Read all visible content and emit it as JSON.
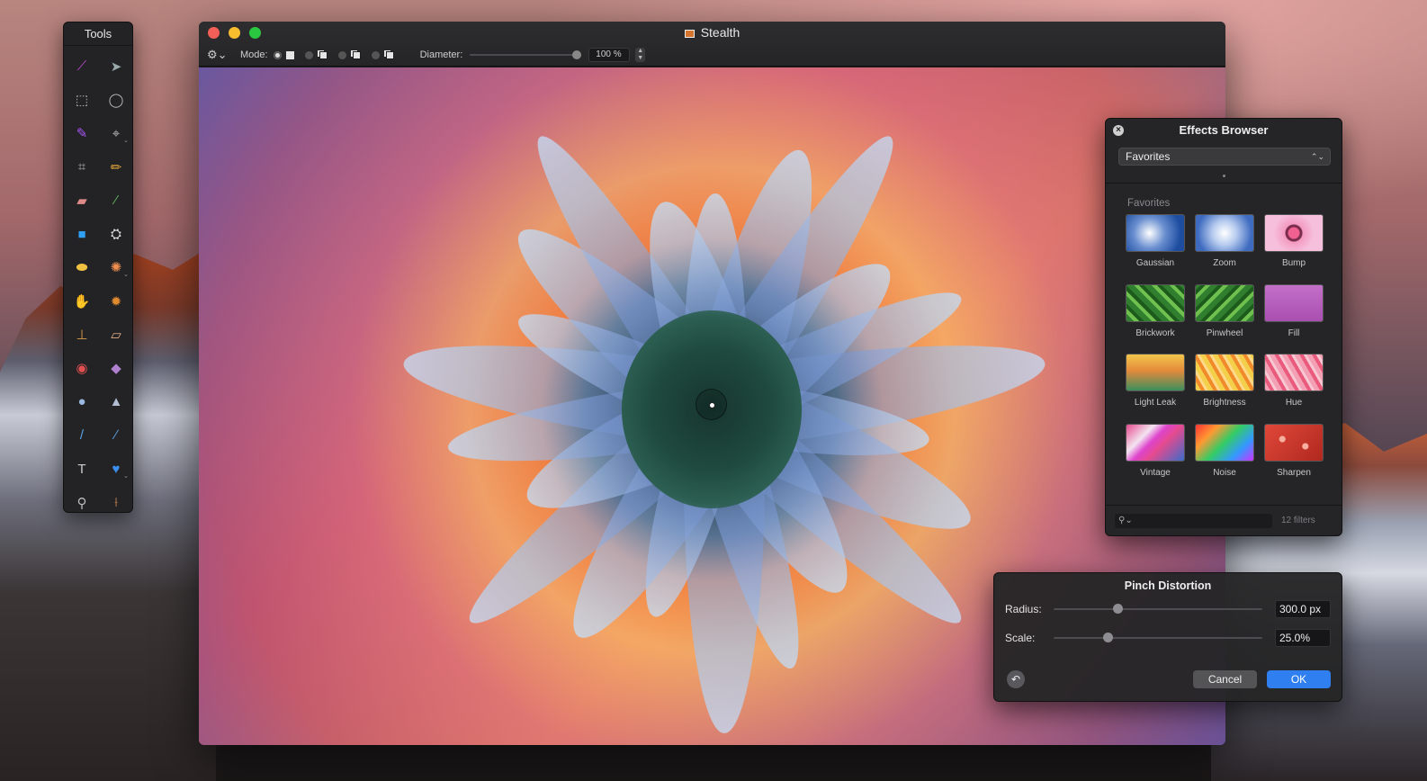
{
  "tools_panel": {
    "title": "Tools",
    "tools": [
      {
        "name": "magic-wand-icon",
        "glyph": "⟋",
        "color": "#c04bd6"
      },
      {
        "name": "arrow-select-icon",
        "glyph": "➤",
        "color": "#9aa"
      },
      {
        "name": "rect-select-icon",
        "glyph": "⬚",
        "color": "#bbb"
      },
      {
        "name": "ellipse-select-icon",
        "glyph": "◯",
        "color": "#bbb"
      },
      {
        "name": "marker-icon",
        "glyph": "✎",
        "color": "#a855f7"
      },
      {
        "name": "lasso-icon",
        "glyph": "⌖",
        "color": "#bbb",
        "more": true
      },
      {
        "name": "crop-icon",
        "glyph": "⌗",
        "color": "#aaa"
      },
      {
        "name": "pencil-icon",
        "glyph": "✏",
        "color": "#e0a63a"
      },
      {
        "name": "eraser-icon",
        "glyph": "▰",
        "color": "#e08a8a"
      },
      {
        "name": "brush-icon",
        "glyph": "⁄",
        "color": "#5fb45f"
      },
      {
        "name": "rectangle-shape-icon",
        "glyph": "■",
        "color": "#2f9ff2"
      },
      {
        "name": "paint-bucket-icon",
        "glyph": "⛭",
        "color": "#ddd"
      },
      {
        "name": "ellipse-shape-icon",
        "glyph": "⬬",
        "color": "#f0c040"
      },
      {
        "name": "color-picker-icon",
        "glyph": "✺",
        "color": "#f09050",
        "more": true
      },
      {
        "name": "smudge-icon",
        "glyph": "✋",
        "color": "#e0a040"
      },
      {
        "name": "burn-icon",
        "glyph": "✹",
        "color": "#e08a30"
      },
      {
        "name": "stamp-icon",
        "glyph": "⊥",
        "color": "#d59a4a"
      },
      {
        "name": "bandage-icon",
        "glyph": "▱",
        "color": "#e6b08a"
      },
      {
        "name": "red-eye-icon",
        "glyph": "◉",
        "color": "#e05050"
      },
      {
        "name": "retouch-icon",
        "glyph": "◆",
        "color": "#b080d0"
      },
      {
        "name": "blur-drop-icon",
        "glyph": "●",
        "color": "#9ab8e0"
      },
      {
        "name": "sharpen-icon",
        "glyph": "▲",
        "color": "#b0bed0"
      },
      {
        "name": "vector-pen-icon",
        "glyph": "/",
        "color": "#5aa0e0"
      },
      {
        "name": "vector-freeform-icon",
        "glyph": "∕",
        "color": "#5aa0e0"
      },
      {
        "name": "text-icon",
        "glyph": "T",
        "color": "#ccc"
      },
      {
        "name": "heart-shape-icon",
        "glyph": "♥",
        "color": "#3b8ff0",
        "more": true
      },
      {
        "name": "zoom-icon",
        "glyph": "⚲",
        "color": "#bbb"
      },
      {
        "name": "eyedropper-icon",
        "glyph": "⟊",
        "color": "#d08a50"
      }
    ]
  },
  "window": {
    "title": "Stealth",
    "toolbar": {
      "mode_label": "Mode:",
      "diameter_label": "Diameter:",
      "diameter_value": "100 %",
      "diameter_level": 1.0
    }
  },
  "effects_browser": {
    "title": "Effects Browser",
    "category_selected": "Favorites",
    "section_label": "Favorites",
    "filters": [
      {
        "name": "Gaussian",
        "thumb": "radial-gradient(circle at 40% 50%, #ffffff, #6a8fd0 40%, #1e4da0 80%)"
      },
      {
        "name": "Zoom",
        "thumb": "radial-gradient(circle at 50% 50%, #ffffff, #b8ccef 35%, #3e6bc0 80%)"
      },
      {
        "name": "Bump",
        "thumb": "radial-gradient(circle at 50% 50%, #f06090 0 6px, #7a2c4c 7px 9px, #f39ac0 10px, #f6c0dc 60%)"
      },
      {
        "name": "Brickwork",
        "thumb": "repeating-linear-gradient(45deg, #2f7f2f 0 6px, #70c050 6px 10px, #1c5b1c 10px 14px)"
      },
      {
        "name": "Pinwheel",
        "thumb": "repeating-linear-gradient(-45deg, #2f7f2f 0 6px, #6fc04e 6px 10px, #1c5b1c 10px 14px)"
      },
      {
        "name": "Fill",
        "thumb": "linear-gradient(180deg, #c370c9, #a94fb0)"
      },
      {
        "name": "Light Leak",
        "thumb": "linear-gradient(180deg, #f2c64a 0%, #e38a3c 45%, #3b8f5c 100%)"
      },
      {
        "name": "Brightness",
        "thumb": "repeating-linear-gradient(60deg, #f4d04a 0 5px, #f08a2a 5px 9px, #ffd98a 9px 12px)"
      },
      {
        "name": "Hue",
        "thumb": "repeating-linear-gradient(60deg, #f3a0b4 0 5px, #e95a7c 5px 9px, #f7c8d2 9px 12px)"
      },
      {
        "name": "Vintage",
        "thumb": "linear-gradient(135deg, #e64a8f 0%, #f3e4f0 30%, #d4c 45%, #e64a8f 60%, #3a6cc9 100%)"
      },
      {
        "name": "Noise",
        "thumb": "linear-gradient(135deg, #f33 0%, #f93 25%, #3c6 50%, #39f 75%, #c3f 100%)"
      },
      {
        "name": "Sharpen",
        "thumb": "radial-gradient(circle at 30% 40%, #f7b0a0 0 3px, rgba(0,0,0,0) 4px), radial-gradient(circle at 70% 60%, #f7b0a0 0 3px, rgba(0,0,0,0) 4px), linear-gradient(135deg, #e0483a, #b0281e)"
      }
    ],
    "filter_count": "12 filters",
    "search_placeholder": "⚲⌄"
  },
  "pinch_distortion": {
    "title": "Pinch Distortion",
    "radius_label": "Radius:",
    "radius_value": "300.0 px",
    "radius_level": 0.3,
    "scale_label": "Scale:",
    "scale_value": "25.0%",
    "scale_level": 0.25,
    "cancel_label": "Cancel",
    "ok_label": "OK"
  }
}
